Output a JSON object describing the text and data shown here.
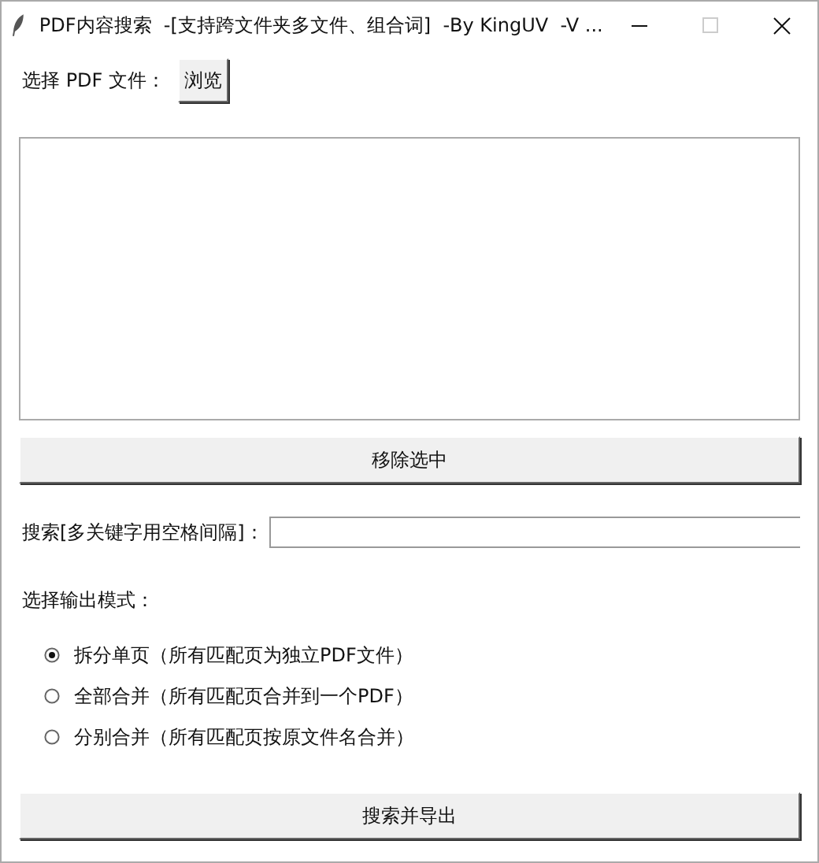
{
  "window": {
    "title": "PDF内容搜索  -[支持跨文件夹多文件、组合词]  -By KingUV  -V ..."
  },
  "file_row": {
    "label": "选择 PDF 文件：",
    "button": "浏览"
  },
  "remove_button": "移除选中",
  "search": {
    "label": "搜索[多关键字用空格间隔]："
  },
  "mode": {
    "label": "选择输出模式：",
    "options": [
      {
        "label": "拆分单页（所有匹配页为独立PDF文件）",
        "selected": true
      },
      {
        "label": "全部合并（所有匹配页合并到一个PDF）",
        "selected": false
      },
      {
        "label": "分别合并（所有匹配页按原文件名合并）",
        "selected": false
      }
    ]
  },
  "export_button": "搜索并导出"
}
